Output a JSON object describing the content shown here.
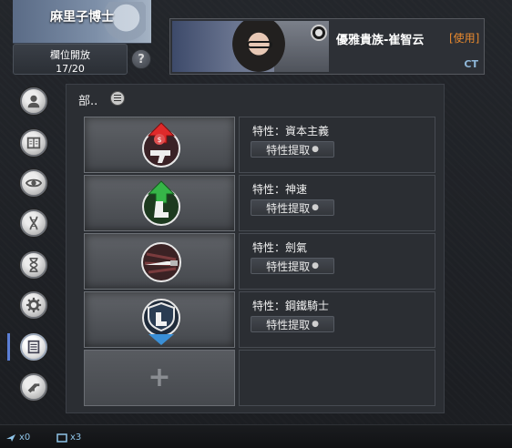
{
  "header": {
    "player_name": "麻里子博士",
    "slot_label": "欄位開放",
    "slot_count": "17/20",
    "help_symbol": "?"
  },
  "character": {
    "name": "優雅貴族-崔智云",
    "status": "[使用]",
    "team": "CT"
  },
  "nav": {
    "items": [
      "profile",
      "book",
      "eye",
      "dna",
      "hourglass",
      "gear",
      "list",
      "gun"
    ],
    "active": "list"
  },
  "section": {
    "title": "部.."
  },
  "traits": [
    {
      "name": "特性：資本主義",
      "button": "特性提取",
      "icon": "capitalism-icon"
    },
    {
      "name": "特性：神速",
      "button": "特性提取",
      "icon": "swift-icon"
    },
    {
      "name": "特性：劍氣",
      "button": "特性提取",
      "icon": "sword-aura-icon"
    },
    {
      "name": "特性：鋼鐵騎士",
      "button": "特性提取",
      "icon": "iron-knight-icon"
    }
  ],
  "add_slot": {
    "symbol": "+"
  },
  "status_bar": {
    "item1": "x0",
    "item2": "x3"
  },
  "colors": {
    "accent_orange": "#e8892e",
    "team_blue": "#8fb7d9",
    "nav_active": "#5b7fd6"
  }
}
